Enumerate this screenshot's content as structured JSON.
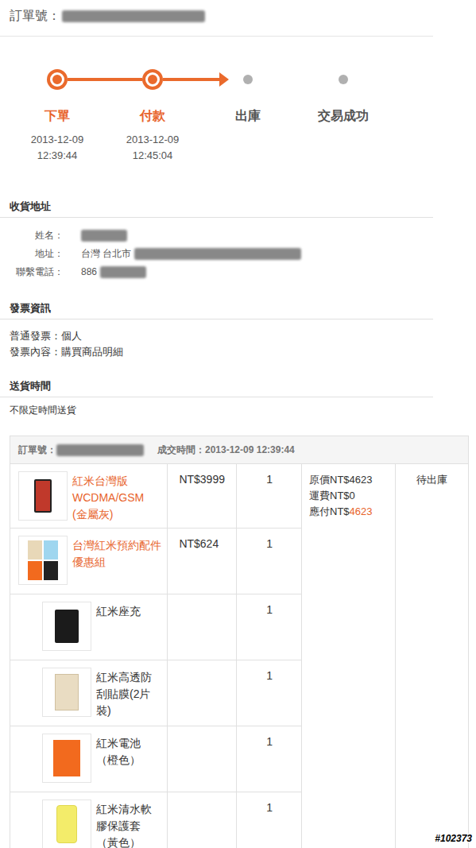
{
  "order": {
    "label": "訂單號：",
    "redacted": true
  },
  "progress": [
    {
      "label": "下單",
      "date": "2013-12-09",
      "time": "12:39:44",
      "done": true
    },
    {
      "label": "付款",
      "date": "2013-12-09",
      "time": "12:45:04",
      "done": true
    },
    {
      "label": "出庫",
      "done": false
    },
    {
      "label": "交易成功",
      "done": false
    }
  ],
  "address": {
    "title": "收貨地址",
    "fields": [
      {
        "label": "姓名：",
        "redacted": true
      },
      {
        "label": "地址：",
        "value": "台灣 台北市",
        "redacted": true
      },
      {
        "label": "聯繫電話：",
        "value": "886",
        "redacted": true
      }
    ]
  },
  "invoice": {
    "title": "發票資訊",
    "lines": [
      "普通發票：個人",
      "發票內容：購買商品明細"
    ]
  },
  "delivery": {
    "title": "送貨時間",
    "lines": [
      "不限定時間送貨"
    ]
  },
  "table": {
    "order_label": "訂單號：",
    "order_redacted": true,
    "time_label": "成交時間：2013-12-09 12:39:44",
    "items": [
      {
        "name": "紅米台灣版WCDMA/GSM (金屬灰)",
        "price": "NT$3999",
        "qty": "1",
        "kind": "phone"
      },
      {
        "name": "台灣紅米預約配件優惠組",
        "price": "NT$624",
        "qty": "1",
        "kind": "bundle",
        "parts": [
          {
            "name": "紅米座充",
            "qty": "1",
            "kind": "charger"
          },
          {
            "name": "紅米高透防刮貼膜(2片裝)",
            "qty": "1",
            "kind": "film"
          },
          {
            "name": "紅米電池（橙色）",
            "qty": "1",
            "kind": "battery"
          },
          {
            "name": "紅米清水軟膠保護套（黃色）",
            "qty": "1",
            "kind": "case"
          }
        ]
      }
    ],
    "summary": [
      {
        "label": "原價NT$",
        "value": "4623",
        "highlight": false
      },
      {
        "label": "運費NT$",
        "value": "0",
        "highlight": false
      },
      {
        "label": "應付NT$",
        "value": "4623",
        "highlight": true
      }
    ],
    "status": "待出庫"
  },
  "watermark": "#102373"
}
